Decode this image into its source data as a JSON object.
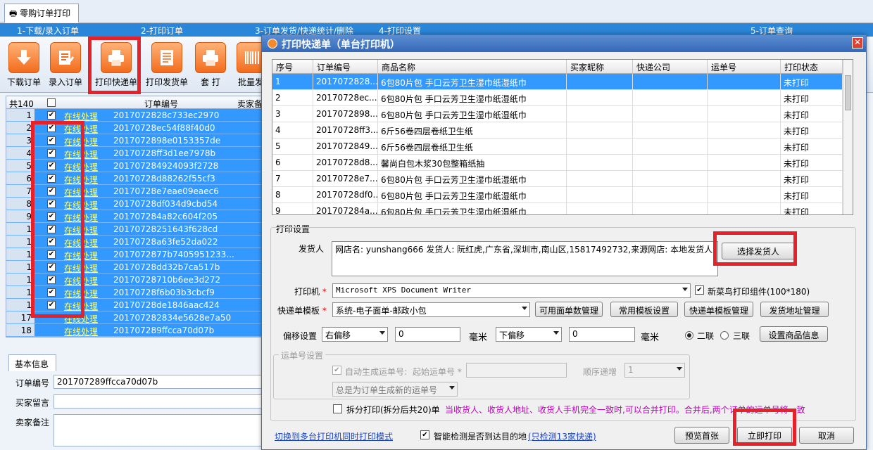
{
  "window_tab": "零购订单打印",
  "steps": [
    "1-下载/录入订单",
    "2-打印订单",
    "3-订单发货/快递统计/删除",
    "4-打印设置",
    "5-订单查询"
  ],
  "toolbar": {
    "download": "下载订单",
    "entry": "录入订单",
    "print_express": "打印快递单",
    "print_invoice": "打印发货单",
    "set_print": "套 打",
    "batch": "批量发"
  },
  "left_grid": {
    "count_label": "共140",
    "col_order": "订单编号",
    "col_seller": "卖家备",
    "rows": [
      {
        "n": "1",
        "link": "在线处理",
        "oid": "2017072828c733ec2970"
      },
      {
        "n": "2",
        "link": "在线处理",
        "oid": "20170728ec54f88f40d0"
      },
      {
        "n": "3",
        "link": "在线处理",
        "oid": "2017072898e0153357de"
      },
      {
        "n": "4",
        "link": "在线处理",
        "oid": "20170728ff3d1ee7978b"
      },
      {
        "n": "5",
        "link": "在线处理",
        "oid": "201707284924093f2728"
      },
      {
        "n": "6",
        "link": "在线处理",
        "oid": "20170728d88262f55cf3"
      },
      {
        "n": "7",
        "link": "在线处理",
        "oid": "20170728e7eae09eaec6"
      },
      {
        "n": "8",
        "link": "在线处理",
        "oid": "20170728df034d9cbd54"
      },
      {
        "n": "9",
        "link": "在线处理",
        "oid": "201707284a82c604f205"
      },
      {
        "n": "1",
        "link": "在线处理",
        "oid": "20170728251643f628cd"
      },
      {
        "n": "1",
        "link": "在线处理",
        "oid": "20170728a63fe52da022"
      },
      {
        "n": "1",
        "link": "在线处理",
        "oid": "2017072877b7405951233..."
      },
      {
        "n": "1",
        "link": "在线处理",
        "oid": "20170728dd32b7ca517b"
      },
      {
        "n": "1",
        "link": "在线处理",
        "oid": "20170728710b6ee3d272"
      },
      {
        "n": "1",
        "link": "在线处理",
        "oid": "20170728f6b03b3cbcf9"
      },
      {
        "n": "1",
        "link": "在线处理",
        "oid": "20170728de1846aac424"
      },
      {
        "n": "17",
        "link": "在线处理",
        "oid": "201707282834e5628e7a50"
      },
      {
        "n": "18",
        "link": "在线处理",
        "oid": "201707289ffcca70d07b"
      }
    ]
  },
  "info": {
    "tab": "基本信息",
    "order_label": "订单编号",
    "order_value": "201707289ffcca70d07b",
    "buyer_msg_label": "买家留言",
    "seller_note_label": "卖家备注"
  },
  "dialog": {
    "title": "打印快递单（单台打印机）",
    "close": "✕",
    "columns": [
      "序号",
      "订单编号",
      "商品名称",
      "买家昵称",
      "快递公司",
      "运单号",
      "打印状态"
    ],
    "rows": [
      {
        "no": "1",
        "oid": "2017072828...",
        "name": "6包80片包 手口云芳卫生湿巾纸湿纸巾",
        "status": "未打印"
      },
      {
        "no": "2",
        "oid": "20170728ec...",
        "name": "6包80片包 手口云芳卫生湿巾纸湿纸巾",
        "status": "未打印"
      },
      {
        "no": "3",
        "oid": "2017072898...",
        "name": "6包80片包 手口云芳卫生湿巾纸湿纸巾",
        "status": "未打印"
      },
      {
        "no": "4",
        "oid": "20170728ff3...",
        "name": "6斤56卷四层卷纸卫生纸",
        "status": "未打印"
      },
      {
        "no": "5",
        "oid": "2017072849...",
        "name": "6斤56卷四层卷纸卫生纸",
        "status": "未打印"
      },
      {
        "no": "6",
        "oid": "20170728d8...",
        "name": "馨尚白包木浆30包整箱纸抽",
        "status": "未打印"
      },
      {
        "no": "7",
        "oid": "20170728e7...",
        "name": "6包80片包 手口云芳卫生湿巾纸湿纸巾",
        "status": "未打印"
      },
      {
        "no": "8",
        "oid": "20170728df0...",
        "name": "6包80片包 手口云芳卫生湿巾纸湿纸巾",
        "status": "未打印"
      },
      {
        "no": "9",
        "oid": "201707284a...",
        "name": "6包80片包 手口云芳卫生湿巾纸湿纸巾",
        "status": "未打印"
      }
    ],
    "print_settings_label": "打印设置",
    "sender_label": "发货人",
    "sender_value": "网店名: yunshang666 发货人: 阮红虎,广东省,深圳市,南山区,15817492732,来源网店: 本地发货人",
    "choose_sender": "选择发货人",
    "printer_label": "打印机",
    "printer_value": "Microsoft XPS Document Writer",
    "cainiao_label": "新菜鸟打印组件(100*180)",
    "template_label": "快递单模板",
    "template_value": "系统-电子面单-邮政小包",
    "btn_available": "可用面单数管理",
    "btn_common_tpl": "常用模板设置",
    "btn_tpl_manage": "快递单模板管理",
    "btn_addr_manage": "发货地址管理",
    "offset_label": "偏移设置",
    "offset_h": "右偏移",
    "offset_h_val": "0",
    "unit1": "毫米",
    "offset_v": "下偏移",
    "offset_v_val": "0",
    "unit2": "毫米",
    "radio_two": "二联",
    "radio_three": "三联",
    "btn_goods_info": "设置商品信息",
    "waybill_group": "运单号设置",
    "auto_gen": "自动生成运单号:",
    "start_no": "起始运单号",
    "seq_inc": "顺序递增",
    "seq_val": "1",
    "always_new": "总是为订单生成新的运单号",
    "split_print": "拆分打印(拆分后共20)单",
    "merge_note": "当收货人、收货人地址、收货人手机完全一致时,可以合并打印。合并后,两个订单的运单号将一致",
    "switch_link": "切换到多台打印机同时打印模式",
    "smart_check": "智能检测是否到达目的地",
    "smart_link": "(只检测13家快递)",
    "btn_preview": "预览首张",
    "btn_print": "立即打印",
    "btn_cancel": "取消"
  }
}
